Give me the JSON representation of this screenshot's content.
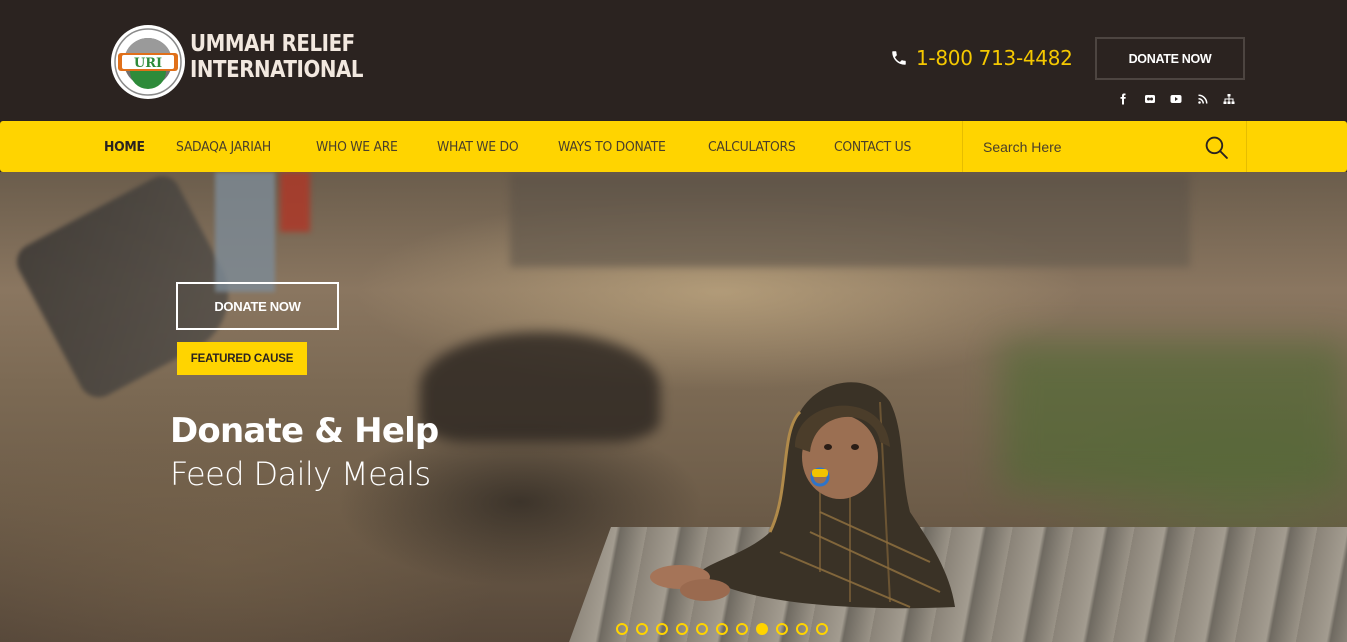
{
  "header": {
    "logo_text": "URI",
    "logo_ring_top": "UMMAH RELIEF",
    "logo_ring_bottom": "INTERNATIONAL",
    "brand_line1": "UMMAH RELIEF",
    "brand_line2": "INTERNATIONAL",
    "phone": "1-800 713-4482",
    "donate_label": "DONATE NOW",
    "socials": [
      "facebook-icon",
      "flickr-icon",
      "youtube-icon",
      "rss-icon",
      "sitemap-icon"
    ]
  },
  "nav": {
    "items": [
      {
        "label": "HOME",
        "active": true
      },
      {
        "label": "SADAQA JARIAH"
      },
      {
        "label": "WHO WE ARE"
      },
      {
        "label": "WHAT WE DO"
      },
      {
        "label": "WAYS TO DONATE"
      },
      {
        "label": "CALCULATORS"
      },
      {
        "label": "CONTACT US"
      }
    ],
    "search_placeholder": "Search Here"
  },
  "hero": {
    "donate_label": "DONATE NOW",
    "badge": "FEATURED CAUSE",
    "title": "Donate & Help",
    "subtitle": "Feed Daily Meals",
    "slides_total": 11,
    "active_slide": 8
  },
  "colors": {
    "accent": "#ffd400",
    "dark": "#2b2320",
    "phone": "#f5c800"
  }
}
